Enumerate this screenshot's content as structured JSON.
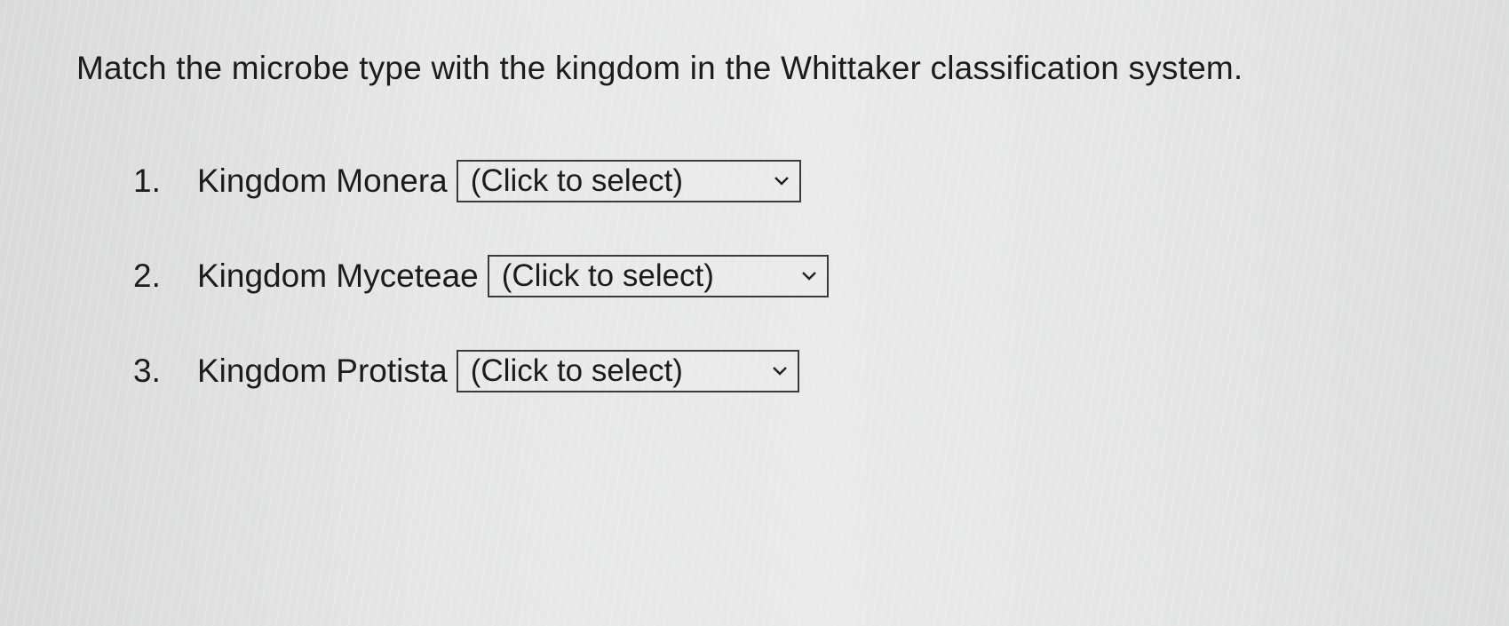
{
  "question": {
    "text": "Match the microbe type with the kingdom in the Whittaker classification system."
  },
  "items": [
    {
      "number": "1.",
      "label": "Kingdom Monera",
      "selected": "(Click to select)"
    },
    {
      "number": "2.",
      "label": "Kingdom Myceteae",
      "selected": "(Click to select)"
    },
    {
      "number": "3.",
      "label": "Kingdom Protista",
      "selected": "(Click to select)"
    }
  ],
  "icons": {
    "dropdown_chevron": "chevron-down-icon"
  }
}
